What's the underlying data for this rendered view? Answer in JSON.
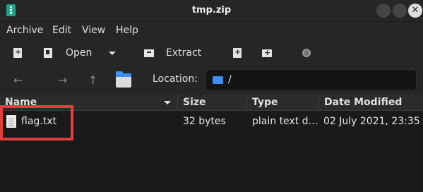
{
  "window": {
    "title": "tmp.zip",
    "close_glyph": "✕"
  },
  "menu": [
    "Archive",
    "Edit",
    "View",
    "Help"
  ],
  "toolbar": {
    "open_label": "Open",
    "extract_label": "Extract"
  },
  "location": {
    "label": "Location:",
    "path": "/"
  },
  "columns": [
    "Name",
    "Size",
    "Type",
    "Date Modified"
  ],
  "files": [
    {
      "name": "flag.txt",
      "size": "32 bytes",
      "type": "plain text d…",
      "modified": "02 July 2021, 23:35"
    }
  ],
  "colors": {
    "highlight": "#e23e3e",
    "folder": "#3d8ff0"
  }
}
